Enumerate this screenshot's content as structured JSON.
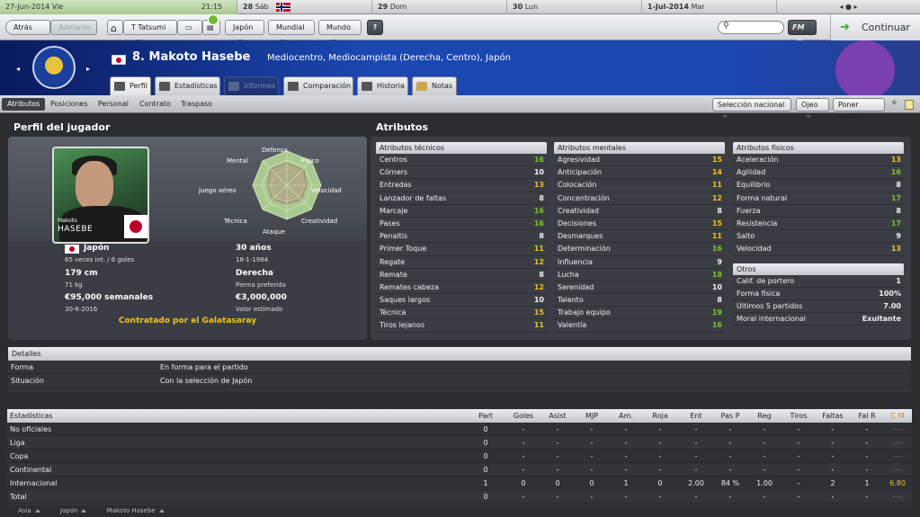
{
  "calendar": {
    "today": {
      "date": "27-Jun-2014 Vie",
      "time": "21:15"
    },
    "days": [
      {
        "day": "28",
        "label": "Sáb",
        "has_flag": true
      },
      {
        "day": "29",
        "label": "Dom"
      },
      {
        "day": "30",
        "label": "Lun"
      },
      {
        "day": "1-Jul-2014",
        "label": "Mar"
      }
    ]
  },
  "toolbar": {
    "back": "Atrás",
    "forward": "Adelante",
    "manager": "T Tatsumi",
    "nation": "Japón",
    "competition": "Mundial",
    "world": "Mundo",
    "help": "?",
    "fm_menu": "FM",
    "continue": "Continuar"
  },
  "header": {
    "number_name": "8. Makoto Hasebe",
    "positions": "Mediocentro, Mediocampista (Derecha, Centro), Japón",
    "tabs": [
      "Perfil",
      "Estadísticas",
      "Informes",
      "Comparación",
      "Historia",
      "Notas"
    ]
  },
  "subtabs": {
    "items": [
      "Atributos",
      "Posiciones",
      "Personal",
      "Contrato",
      "Traspaso"
    ],
    "selection": "Selección nacional",
    "scout": "Ojeo",
    "loan": "Poner apodo"
  },
  "profile": {
    "title": "Perfil del jugador",
    "photo_first": "Makoto",
    "photo_last": "HASEBE",
    "radar_labels": {
      "top": "Defensa",
      "top_right": "Físico",
      "right": "Velocidad",
      "bottom_right": "Creatividad",
      "bottom": "Ataque",
      "bottom_left": "Técnica",
      "left": "Juego aéreo",
      "top_left": "Mental"
    },
    "nationality": "Japón",
    "caps": "65 veces int. / 6 goles",
    "age": "30 años",
    "dob": "18-1-1984",
    "height": "179 cm",
    "weight": "71 kg",
    "foot": "Derecha",
    "foot_label": "Pierna preferida",
    "wage": "€95,000 semanales",
    "contract_end": "30-6-2016",
    "value": "€3,000,000",
    "value_label": "Valor estimado",
    "contracted": "Contratado por el Galatasaray"
  },
  "attributes": {
    "title": "Atributos",
    "technical": {
      "header": "Atributos técnicos",
      "items": [
        {
          "name": "Centros",
          "value": "16",
          "tone": "g"
        },
        {
          "name": "Córners",
          "value": "10",
          "tone": "w"
        },
        {
          "name": "Entradas",
          "value": "13",
          "tone": "y"
        },
        {
          "name": "Lanzador de faltas",
          "value": "8",
          "tone": "w"
        },
        {
          "name": "Marcaje",
          "value": "16",
          "tone": "g"
        },
        {
          "name": "Pases",
          "value": "16",
          "tone": "g"
        },
        {
          "name": "Penaltis",
          "value": "8",
          "tone": "w"
        },
        {
          "name": "Primer Toque",
          "value": "11",
          "tone": "y"
        },
        {
          "name": "Regate",
          "value": "12",
          "tone": "y"
        },
        {
          "name": "Remate",
          "value": "8",
          "tone": "w"
        },
        {
          "name": "Remates cabeza",
          "value": "12",
          "tone": "y"
        },
        {
          "name": "Saques largos",
          "value": "10",
          "tone": "w"
        },
        {
          "name": "Técnica",
          "value": "15",
          "tone": "y"
        },
        {
          "name": "Tiros lejanos",
          "value": "11",
          "tone": "y"
        }
      ]
    },
    "mental": {
      "header": "Atributos mentales",
      "items": [
        {
          "name": "Agresividad",
          "value": "15",
          "tone": "y"
        },
        {
          "name": "Anticipación",
          "value": "14",
          "tone": "y"
        },
        {
          "name": "Colocación",
          "value": "11",
          "tone": "y"
        },
        {
          "name": "Concentración",
          "value": "12",
          "tone": "y"
        },
        {
          "name": "Creatividad",
          "value": "8",
          "tone": "w"
        },
        {
          "name": "Decisiones",
          "value": "15",
          "tone": "y"
        },
        {
          "name": "Desmarques",
          "value": "11",
          "tone": "y"
        },
        {
          "name": "Determinación",
          "value": "16",
          "tone": "g"
        },
        {
          "name": "Influencia",
          "value": "9",
          "tone": "w"
        },
        {
          "name": "Lucha",
          "value": "18",
          "tone": "g"
        },
        {
          "name": "Serenidad",
          "value": "10",
          "tone": "w"
        },
        {
          "name": "Talento",
          "value": "8",
          "tone": "w"
        },
        {
          "name": "Trabajo equipo",
          "value": "19",
          "tone": "g"
        },
        {
          "name": "Valentía",
          "value": "16",
          "tone": "g"
        }
      ]
    },
    "physical": {
      "header": "Atributos físicos",
      "items": [
        {
          "name": "Aceleración",
          "value": "13",
          "tone": "y"
        },
        {
          "name": "Agilidad",
          "value": "16",
          "tone": "g"
        },
        {
          "name": "Equilibrio",
          "value": "8",
          "tone": "w"
        },
        {
          "name": "Forma natural",
          "value": "17",
          "tone": "g"
        },
        {
          "name": "Fuerza",
          "value": "8",
          "tone": "w"
        },
        {
          "name": "Resistencia",
          "value": "17",
          "tone": "g"
        },
        {
          "name": "Salto",
          "value": "9",
          "tone": "w"
        },
        {
          "name": "Velocidad",
          "value": "13",
          "tone": "y"
        }
      ]
    },
    "other": {
      "header": "Otros",
      "items": [
        {
          "name": "Calif. de portero",
          "value": "1",
          "tone": "w"
        },
        {
          "name": "Forma física",
          "value": "100%",
          "tone": "w"
        },
        {
          "name": "Últimos 5 partidos",
          "value": "7.00",
          "tone": "w"
        },
        {
          "name": "Moral internacional",
          "value": "Exultante",
          "tone": "w"
        }
      ]
    }
  },
  "details": {
    "header": "Detalles",
    "rows": [
      {
        "label": "Forma",
        "value": "En forma para el partido"
      },
      {
        "label": "Situación",
        "value": "Con la selección de Japón"
      }
    ]
  },
  "stats": {
    "header": "Estadísticas",
    "columns": [
      "Part",
      "Goles",
      "Asist",
      "MJP",
      "Am.",
      "Roja",
      "Ent",
      "Pas P",
      "Reg",
      "Tiros",
      "Faltas",
      "Fal R",
      "C M"
    ],
    "rows": [
      {
        "name": "No oficiales",
        "cells": [
          "0",
          "-",
          "-",
          "-",
          "-",
          "-",
          "-",
          "-",
          "-",
          "-",
          "-",
          "-",
          "----"
        ]
      },
      {
        "name": "Liga",
        "cells": [
          "0",
          "-",
          "-",
          "-",
          "-",
          "-",
          "-",
          "-",
          "-",
          "-",
          "-",
          "-",
          "----"
        ]
      },
      {
        "name": "Copa",
        "cells": [
          "0",
          "-",
          "-",
          "-",
          "-",
          "-",
          "-",
          "-",
          "-",
          "-",
          "-",
          "-",
          "----"
        ]
      },
      {
        "name": "Continental",
        "cells": [
          "0",
          "-",
          "-",
          "-",
          "-",
          "-",
          "-",
          "-",
          "-",
          "-",
          "-",
          "-",
          "----"
        ]
      },
      {
        "name": "Internacional",
        "cells": [
          "1",
          "0",
          "0",
          "0",
          "1",
          "0",
          "2.00",
          "84 %",
          "1.00",
          "-",
          "2",
          "1",
          "6.80"
        ]
      },
      {
        "name": "Total",
        "cells": [
          "0",
          "-",
          "-",
          "-",
          "-",
          "-",
          "-",
          "-",
          "-",
          "-",
          "-",
          "-",
          "----"
        ]
      }
    ]
  },
  "footer": {
    "crumbs": [
      "Asia",
      "Japón",
      "Makoto Hasebe"
    ]
  },
  "colors": {
    "high": "#7fc02a",
    "mid": "#f0c020",
    "accent": "#1a47b0",
    "continue_arrow": "#3aa035"
  }
}
